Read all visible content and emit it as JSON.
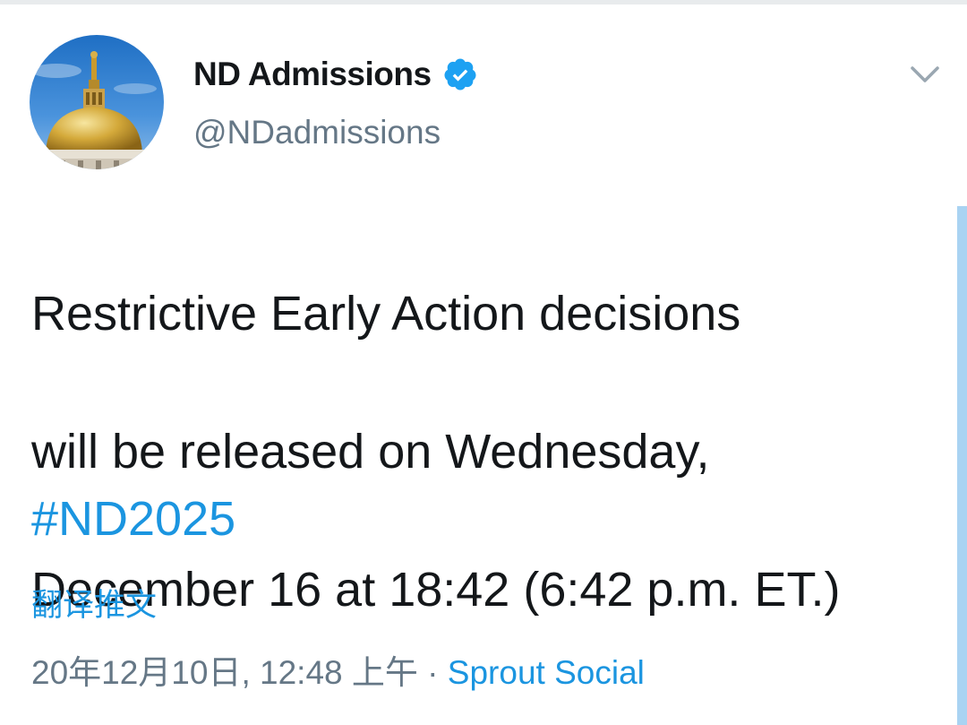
{
  "tweet": {
    "author": {
      "display_name": "ND Admissions",
      "handle": "@NDadmissions",
      "verified": true,
      "avatar_icon": "golden-dome-avatar-icon"
    },
    "text_lines": [
      "Restrictive Early Action decisions",
      "will be released on Wednesday,",
      "December 16 at 18:42 (6:42 p.m. ET.)"
    ],
    "hashtag": "#ND2025",
    "translate_label": "翻译推文",
    "timestamp": "20年12月10日, 12:48 上午",
    "separator": " · ",
    "source": "Sprout Social"
  },
  "icons": {
    "verified": "verified-badge-icon",
    "more": "chevron-down-icon"
  },
  "colors": {
    "link": "#1b95e0",
    "text": "#14171a",
    "secondary": "#657786",
    "verified": "#1da1f2"
  }
}
